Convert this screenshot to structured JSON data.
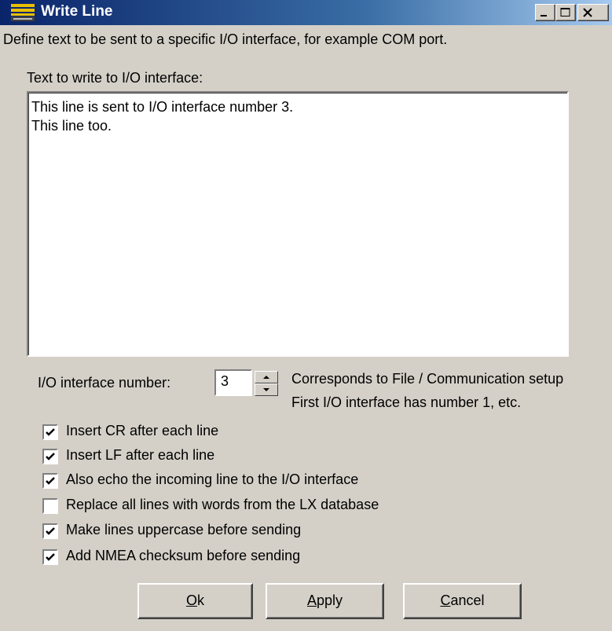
{
  "window": {
    "title": "Write Line",
    "icon": "app-logo-icon",
    "controls": [
      "minimize-icon",
      "maximize-icon",
      "close-icon"
    ]
  },
  "description": "Define text to be sent to a specific I/O interface, for example COM port.",
  "text_area": {
    "label": "Text to write to I/O interface:",
    "lines": [
      "This line is sent to I/O interface number 3.",
      "This line too."
    ]
  },
  "interface": {
    "label": "I/O interface number:",
    "value": "3",
    "hint1": "Corresponds to File / Communication setup",
    "hint2": "First I/O interface has number 1, etc."
  },
  "options": [
    {
      "label": "Insert CR after each line",
      "checked": true
    },
    {
      "label": "Insert LF after each line",
      "checked": true
    },
    {
      "label": "Also echo the incoming line to the I/O interface",
      "checked": true
    },
    {
      "label": "Replace all lines with words from the LX database",
      "checked": false
    },
    {
      "label": "Make lines uppercase before sending",
      "checked": true
    },
    {
      "label": "Add NMEA checksum before sending",
      "checked": true
    }
  ],
  "buttons": {
    "ok": {
      "mnemonic": "O",
      "rest": "k"
    },
    "apply": {
      "mnemonic": "A",
      "rest": "pply"
    },
    "cancel": {
      "mnemonic": "C",
      "rest": "ancel"
    }
  }
}
